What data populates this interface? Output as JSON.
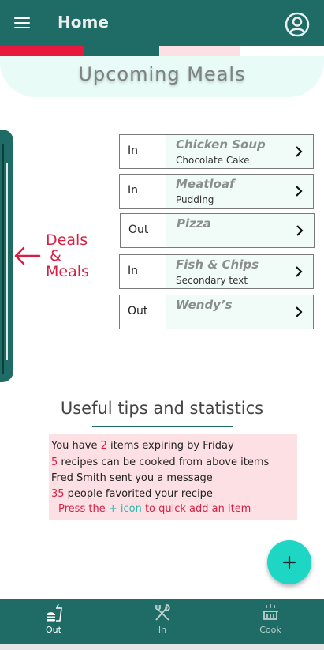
{
  "app_bar": {
    "title": "Home",
    "menu_icon": "menu-icon",
    "account_icon": "account-circle-icon"
  },
  "upcoming": {
    "title": "Upcoming Meals",
    "meals": [
      {
        "type": "In",
        "name": "Chicken Soup",
        "detail": "Chocolate Cake"
      },
      {
        "type": "In",
        "name": "Meatloaf",
        "detail": "Pudding"
      },
      {
        "type": "Out",
        "name": "Pizza",
        "detail": ""
      },
      {
        "type": "In",
        "name": "Fish & Chips",
        "detail": "Secondary text"
      },
      {
        "type": "Out",
        "name": "Wendy’s",
        "detail": ""
      }
    ]
  },
  "deals": {
    "line1": "Deals",
    "line2": "&",
    "line3": "Meals"
  },
  "tips": {
    "title": "Useful tips and statistics",
    "line1": {
      "pre": "You have ",
      "num": "2",
      "post": " items expiring by Friday"
    },
    "line2": {
      "num": "5",
      "post": " recipes can be cooked from above items"
    },
    "line3": "Fred Smith sent you a message",
    "line4": {
      "num": "35",
      "post": " people favorited your recipe"
    },
    "hint": {
      "pre": "Press the ",
      "accent": "+ icon",
      "post": " to quick add an item"
    }
  },
  "fab": {
    "icon": "plus-icon"
  },
  "bottom_nav": {
    "items": [
      {
        "label": "Out",
        "icon": "fastfood-icon",
        "active": true
      },
      {
        "label": "In",
        "icon": "restaurant-icon",
        "active": false
      },
      {
        "label": "Cook",
        "icon": "cooker-icon",
        "active": false
      }
    ]
  },
  "colors": {
    "primary": "#1f6b66",
    "accent": "#1dd6c3",
    "alert": "#d81f43",
    "pink": "#fde0e4",
    "mint": "#e8fbf6"
  }
}
